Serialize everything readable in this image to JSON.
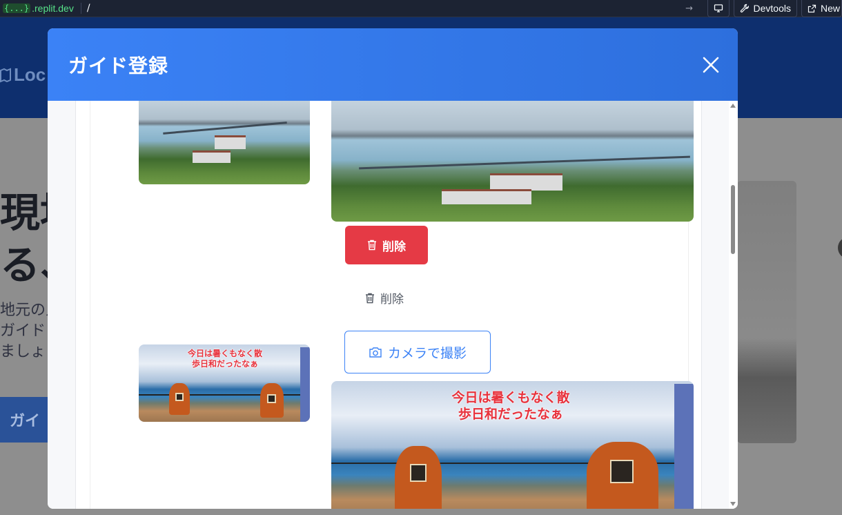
{
  "browser": {
    "domain_brace": "{...}",
    "domain": ".replit.dev",
    "path": "/",
    "devtools_label": "Devtools",
    "new_tab_label": "New"
  },
  "background_page": {
    "logo_text": "Loc",
    "hero_lines": [
      "現地",
      "る、"
    ],
    "sub_lines": [
      "地元の人",
      "ガイドと",
      "ましょう"
    ],
    "cta_label": "ガイ"
  },
  "modal": {
    "title": "ガイド登録",
    "photo_overlay_text_1": "今日は暑くもなく散",
    "photo_overlay_text_2": "歩日和だったなぁ",
    "delete_primary_label": "削除",
    "delete_secondary_label": "削除",
    "camera_button_label": "カメラで撮影"
  },
  "colors": {
    "modal_header": "#3b82f6",
    "delete_red": "#e53a45",
    "camera_blue": "#3b82f6",
    "domain_green": "#57e389"
  }
}
